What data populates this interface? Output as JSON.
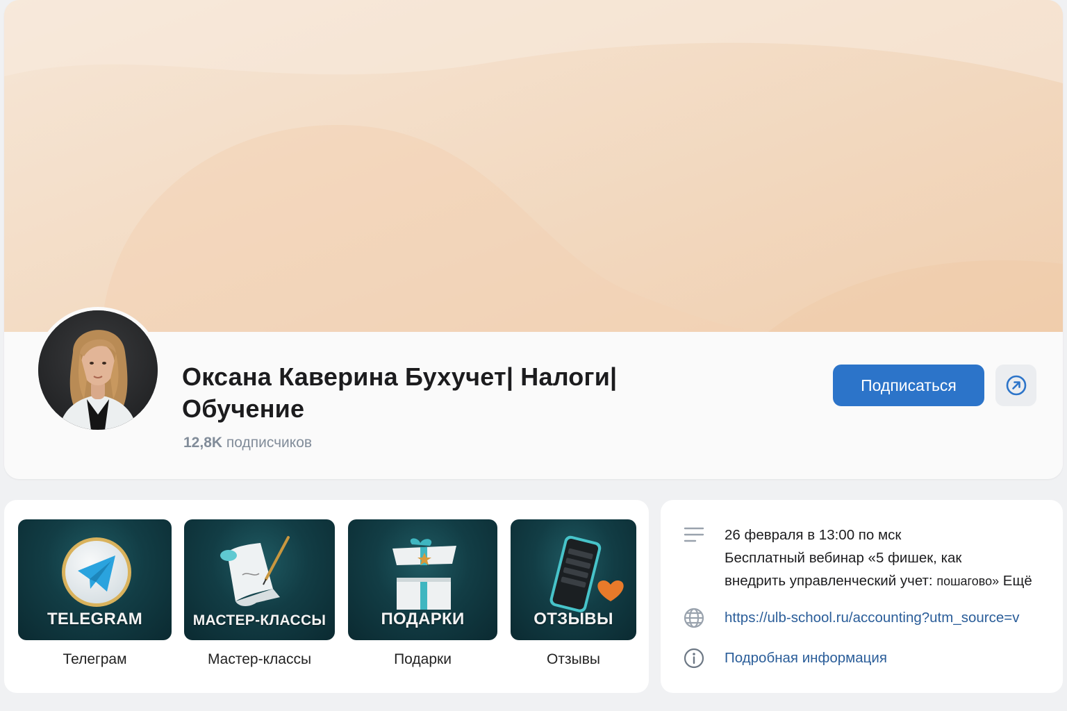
{
  "header": {
    "title": "Оксана Каверина Бухучет| Налоги| Обучение",
    "subscribers_count": "12,8K",
    "subscribers_label": "подписчиков",
    "subscribe_label": "Подписаться",
    "share_icon": "arrow-up-right-circle-icon"
  },
  "services": [
    {
      "tile_text": "TELEGRAM",
      "caption": "Телеграм",
      "icon": "telegram-logo-icon"
    },
    {
      "tile_text": "МАСТЕР-КЛАССЫ",
      "caption": "Мастер-классы",
      "icon": "scroll-quill-icon"
    },
    {
      "tile_text": "ПОДАРКИ",
      "caption": "Подарки",
      "icon": "gift-box-icon"
    },
    {
      "tile_text": "ОТЗЫВЫ",
      "caption": "Отзывы",
      "icon": "phone-heart-icon"
    }
  ],
  "about": {
    "description_line1": "26 февраля в 13:00 по мск",
    "description_line2": "Бесплатный вебинар «5 фишек, как",
    "description_line3a": "внедрить управленческий учет: ",
    "description_line3b": "пошагово»",
    "more_label": " Ещё",
    "link": "https://ulb-school.ru/accounting?utm_source=v",
    "details_label": "Подробная информация"
  },
  "colors": {
    "accent": "#2c74c9",
    "link": "#2a5d99",
    "cover": "#f3dcc5",
    "tile_bg": "#123d45"
  }
}
